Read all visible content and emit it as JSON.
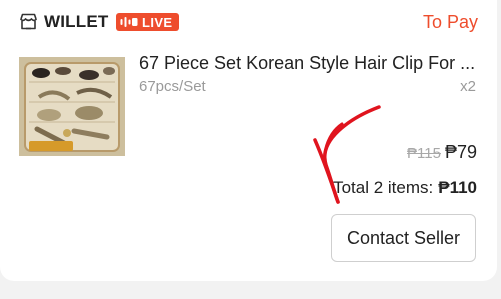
{
  "header": {
    "shop_icon": "shop-icon",
    "shop_name": "WILLET",
    "live_badge": {
      "icon": "live-stream-icon",
      "label": "LIVE"
    },
    "status": "To Pay"
  },
  "product": {
    "thumbnail_icon": "product-thumbnail-hair-clips",
    "title": "67 Piece Set Korean Style Hair Clip For ...",
    "variant": "67pcs/Set",
    "quantity": "x2",
    "price_original": "₱115",
    "price_current": "₱79"
  },
  "summary": {
    "total_label": "Total 2 items:",
    "total_amount": "₱110"
  },
  "actions": {
    "contact_label": "Contact Seller"
  },
  "annotation": {
    "icon": "red-hand-drawn-arrow",
    "color": "#e0141e"
  },
  "colors": {
    "accent": "#ee4d2d",
    "text": "#222222",
    "muted": "#9a9a9a",
    "background": "#f2f2f2"
  }
}
